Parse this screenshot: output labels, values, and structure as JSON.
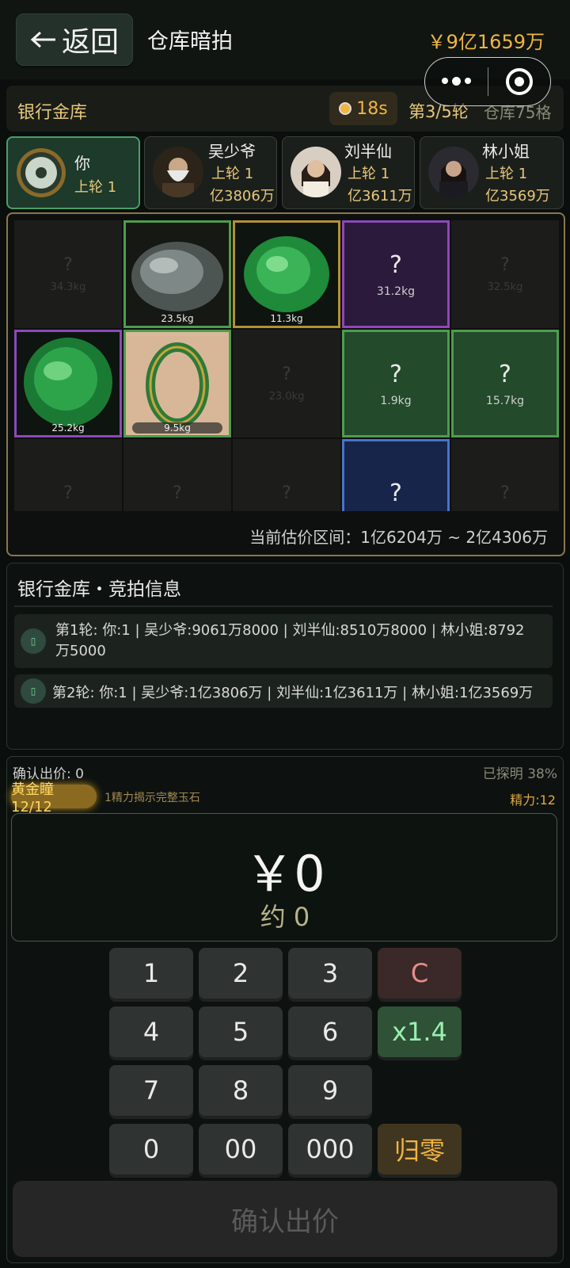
{
  "header": {
    "back_label": "返回",
    "title": "仓库暗拍",
    "balance": "￥9亿1659万"
  },
  "vault": {
    "name": "银行金库",
    "timer": "18s",
    "round": "第3/5轮",
    "capacity": "仓库75格"
  },
  "players": [
    {
      "name": "你",
      "last": "上轮 1",
      "bid": ""
    },
    {
      "name": "吴少爷",
      "last": "上轮 1",
      "bid": "亿3806万"
    },
    {
      "name": "刘半仙",
      "last": "上轮 1",
      "bid": "亿3611万"
    },
    {
      "name": "林小姐",
      "last": "上轮 1",
      "bid": "亿3569万"
    }
  ],
  "grid": {
    "cells": [
      {
        "w": "34.3kg"
      },
      {
        "w": "23.5kg"
      },
      {
        "w": "11.3kg"
      },
      {
        "q": "?",
        "w": "31.2kg"
      },
      {
        "w": "32.5kg"
      },
      {
        "w": "25.2kg"
      },
      {
        "w": "9.5kg"
      },
      {
        "w": "23.0kg"
      },
      {
        "q": "?",
        "w": "1.9kg"
      },
      {
        "q": "?",
        "w": "15.7kg"
      },
      {
        "w": ""
      },
      {
        "w": ""
      },
      {
        "w": ""
      },
      {
        "q": "?"
      },
      {
        "w": ""
      }
    ],
    "hidden_q": "?",
    "range": "当前估价区间：1亿6204万 ~ 2亿4306万"
  },
  "bid_info": {
    "title": "银行金库・竞拍信息",
    "rows": [
      "第1轮: 你:1 | 吴少爷:9061万8000 | 刘半仙:8510万8000 | 林小姐:8792万5000",
      "第2轮: 你:1 | 吴少爷:1亿3806万 | 刘半仙:1亿3611万 | 林小姐:1亿3569万"
    ],
    "row1_a": "第1轮: 你:1 | 吴少爷:9061万8000 | 刘半仙:8510万8000 | 林小姐:8792",
    "row1_b": "万5000"
  },
  "panel": {
    "confirm_count": "确认出价: 0",
    "explored": "已探明 38%",
    "eye_label": "黄金瞳 12/12",
    "eye_desc": "1精力揭示完整玉石",
    "energy": "精力:12",
    "amount": "￥0",
    "approx": "约 0",
    "keys": {
      "k1": "1",
      "k2": "2",
      "k3": "3",
      "clear": "C",
      "k4": "4",
      "k5": "5",
      "k6": "6",
      "mult": "x1.4",
      "k7": "7",
      "k8": "8",
      "k9": "9",
      "k0": "0",
      "k00": "00",
      "k000": "000",
      "reset": "归零"
    },
    "submit": "确认出价"
  },
  "colors": {
    "accent_gold": "#f0b543",
    "green": "#4e9c4e",
    "purple": "#8c49b8",
    "blue": "#4a73c9"
  }
}
